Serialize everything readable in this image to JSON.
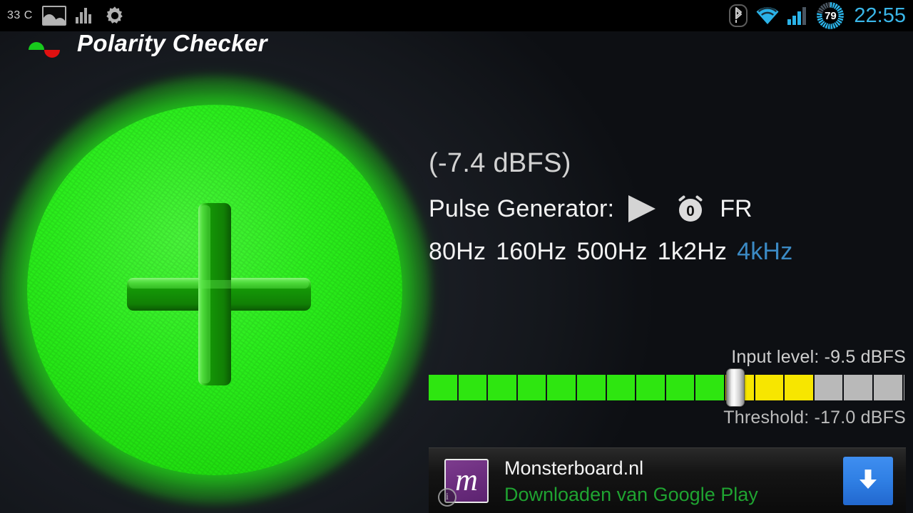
{
  "status_bar": {
    "temperature": "33 C",
    "icons": [
      "photo-icon",
      "bar-chart-icon",
      "gear-icon",
      "bluetooth-icon",
      "wifi-icon",
      "signal-icon"
    ],
    "battery_percent": "79",
    "clock": "22:55"
  },
  "header": {
    "title": "Polarity Checker",
    "logo": "polarity-waveform-icon"
  },
  "indicator": {
    "polarity": "positive",
    "symbol": "plus-icon",
    "color": "#2cef1d"
  },
  "readout": {
    "dbfs_reading": "(-7.4 dBFS)",
    "pulse_generator_label": "Pulse Generator:",
    "play_icon": "play-icon",
    "timer_icon": "stopwatch-icon",
    "channel": "FR",
    "frequencies": [
      {
        "label": "80Hz",
        "active": false
      },
      {
        "label": "160Hz",
        "active": false
      },
      {
        "label": "500Hz",
        "active": false
      },
      {
        "label": "1k2Hz",
        "active": false
      },
      {
        "label": "4kHz",
        "active": true
      }
    ],
    "active_color": "#3b8ac4"
  },
  "meter": {
    "input_level_label": "Input level: -9.5 dBFS",
    "threshold_label": "Threshold: -17.0 dBFS",
    "green_color": "#2ee610",
    "yellow_color": "#f7e600",
    "empty_color": "#b9b9b9"
  },
  "ad": {
    "icon_letter": "m",
    "info_badge": "i",
    "title": "Monsterboard.nl",
    "subtitle": "Downloaden van Google Play",
    "cta_icon": "download-arrow-icon",
    "cta_color": "#2f7fe4"
  }
}
